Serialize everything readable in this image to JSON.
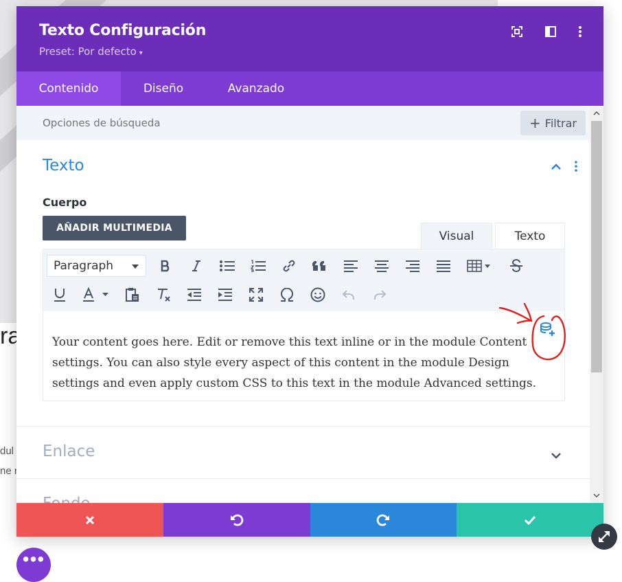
{
  "background": {
    "partial_heading": "ra",
    "partial_line1": "dul",
    "partial_line2": "ne r"
  },
  "modal": {
    "title": "Texto Configuración",
    "preset_label": "Preset: Por defecto",
    "preset_caret": "▾"
  },
  "tabs": [
    {
      "label": "Contenido",
      "active": true
    },
    {
      "label": "Diseño",
      "active": false
    },
    {
      "label": "Avanzado",
      "active": false
    }
  ],
  "search": {
    "placeholder": "Opciones de búsqueda",
    "filter_label": "Filtrar"
  },
  "text_section": {
    "title": "Texto",
    "body_label": "Cuerpo",
    "add_media_label": "AÑADIR MULTIMEDIA"
  },
  "editor": {
    "tab_visual": "Visual",
    "tab_text": "Texto",
    "format_select": "Paragraph",
    "content": "Your content goes here. Edit or remove this text inline or in the module Content settings. You can also style every aspect of this content in the module Design settings and even apply custom CSS to this text in the module Advanced settings."
  },
  "collapsed_sections": {
    "link": "Enlace",
    "background": "Fondo"
  },
  "colors": {
    "header": "#6c2eb9",
    "tabs": "#7d3bd3",
    "active_tab": "#8f4ae6",
    "accent_blue": "#2b87da",
    "discard": "#ef5555",
    "undo": "#7d3bd3",
    "redo": "#2b87da",
    "save": "#29c4a9",
    "annotation": "#e0201e"
  },
  "icons": {
    "header": [
      "fullscreen-icon",
      "split-view-icon",
      "more-vertical-icon"
    ],
    "footer": [
      "close-icon",
      "undo-icon",
      "redo-icon",
      "check-icon"
    ]
  }
}
